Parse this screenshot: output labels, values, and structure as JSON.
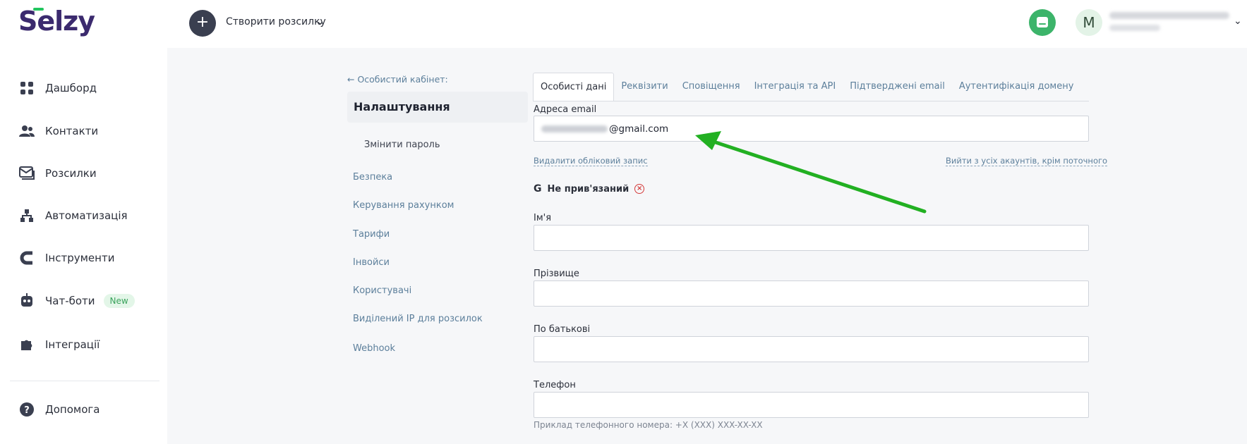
{
  "header": {
    "logo": "Selzy",
    "create_label": "Створити розсилку",
    "create_icon": "plus-icon",
    "avatar_letter": "M"
  },
  "sidebar": {
    "items": [
      {
        "label": "Дашборд",
        "icon": "dashboard-icon"
      },
      {
        "label": "Контакти",
        "icon": "contacts-icon"
      },
      {
        "label": "Розсилки",
        "icon": "mail-icon"
      },
      {
        "label": "Автоматизація",
        "icon": "automation-icon"
      },
      {
        "label": "Інструменти",
        "icon": "magnet-icon"
      },
      {
        "label": "Чат-боти",
        "icon": "robot-icon",
        "badge": "New"
      },
      {
        "label": "Інтеграції",
        "icon": "puzzle-icon"
      }
    ],
    "help": {
      "label": "Допомога",
      "icon": "help-icon"
    }
  },
  "settings_nav": {
    "back": "← Особистий кабінет:",
    "title": "Налаштування",
    "items": [
      "Змінити пароль",
      "Безпека",
      "Керування рахунком",
      "Тарифи",
      "Інвойси",
      "Користувачі",
      "Виділений IP для розсилок",
      "Webhook"
    ]
  },
  "tabs": [
    "Особисті дані",
    "Реквізити",
    "Сповіщення",
    "Інтеграція та API",
    "Підтверджені email",
    "Аутентифікація домену"
  ],
  "form": {
    "email_label": "Адреса email",
    "email_value": "@gmail.com",
    "delete_account": "Видалити обліковий запис",
    "logout_all": "Вийти з усіх акаунтів, крім поточного",
    "google_status": "Не прив'язаний",
    "first_name_label": "Ім'я",
    "last_name_label": "Прізвище",
    "patronymic_label": "По батькові",
    "phone_label": "Телефон",
    "phone_hint": "Приклад телефонного номера: +X (XXX) XXX-XX-XX"
  },
  "colors": {
    "brand": "#3b2a6e",
    "accent_green": "#22c55e",
    "link": "#5c7f9b",
    "annotation_arrow": "#22b022"
  }
}
